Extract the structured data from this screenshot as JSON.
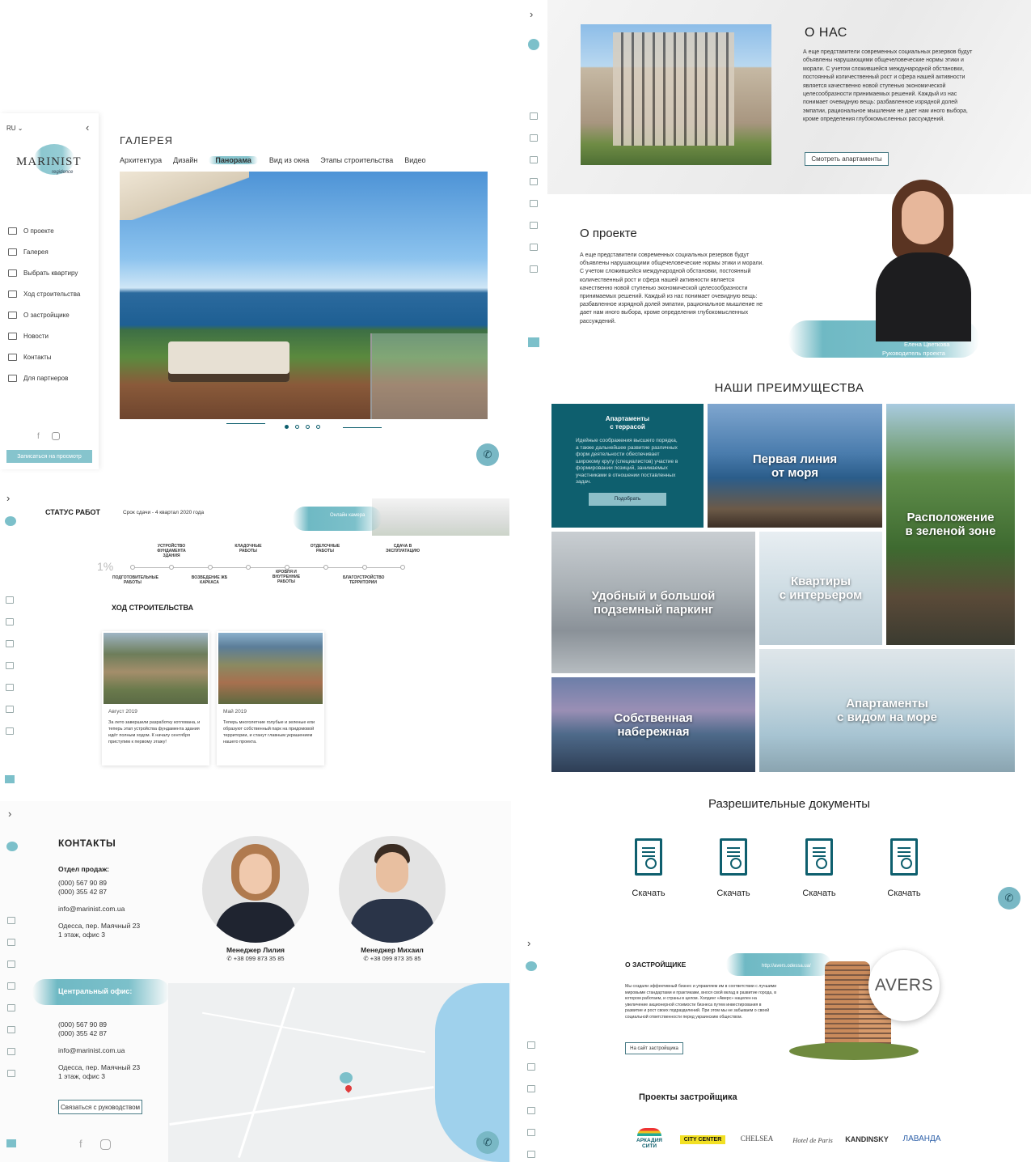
{
  "gallery": {
    "lang": "RU",
    "logo_text": "MARINIST",
    "logo_sub": "regidence",
    "title": "ГАЛЕРЕЯ",
    "tabs": [
      "Архитектура",
      "Дизайн",
      "Панорама",
      "Вид из окна",
      "Этапы строительства",
      "Видео"
    ],
    "active_tab": "Панорама",
    "nav": [
      "О проекте",
      "Галерея",
      "Выбрать квартиру",
      "Ход строительства",
      "О застройщике",
      "Новости",
      "Контакты",
      "Для партнеров"
    ],
    "cta": "Записаться на просмотр"
  },
  "about_us": {
    "title": "О НАС",
    "text": "А еще представители современных социальных резервов будут объявлены нарушающими общечеловеческие нормы этики и морали. С учетом сложившейся международной обстановки, постоянный количественный рост и сфера нашей активности является качественно новой ступенью экономической целесообразности принимаемых решений. Каждый из нас понимает очевидную вещь: разбавленное изрядной долей эмпатии, рациональное мышление не дает нам иного выбора, кроме определения глубокомысленных рассуждений.",
    "button": "Смотреть апартаменты"
  },
  "project": {
    "title": "О проекте",
    "text": "А еще представители современных социальных резервов будут объявлены нарушающими общечеловеческие нормы этики и морали. С учетом сложившейся международной обстановки, постоянный количественный рост и сфера нашей активности является качественно новой ступенью экономической целесообразности принимаемых решений. Каждый из нас понимает очевидную вещь: разбавленное изрядной долей эмпатии, рациональное мышление не дает нам иного выбора, кроме определения глубокомысленных рассуждений.",
    "person_name": "Елена Цветкова",
    "person_role": "Руководитель проекта"
  },
  "advantages": {
    "title": "НАШИ ПРЕИМУЩЕСТВА",
    "featured_title": "Апартаменты\nс террасой",
    "featured_text": "Идейные соображения высшего порядка, а также дальнейшее развитие различных форм деятельности обеспечивает широкому кругу (специалистов) участие в формировании позиций, занимаемых участниками в отношении поставленных задач.",
    "featured_button": "Подобрать",
    "tiles": [
      "Первая линия\nот моря",
      "Расположение\nв зеленой зоне",
      "Удобный и большой\nподземный паркинг",
      "Квартиры\nс интерьером",
      "Собственная\nнабережная",
      "Апартаменты\nс видом на море"
    ]
  },
  "documents": {
    "title": "Разрешительные документы",
    "items": [
      "Скачать",
      "Скачать",
      "Скачать",
      "Скачать"
    ]
  },
  "status": {
    "title": "СТАТУС РАБОТ",
    "deadline": "Срок сдачи - 4 квартал 2020 года",
    "camera": "Онлайн камера",
    "percent": "1%",
    "steps_top": [
      "УСТРОЙСТВО ФУНДАМЕНТА ЗДАНИЯ",
      "КЛАДОЧНЫЕ РАБОТЫ",
      "ОТДЕЛОЧНЫЕ РАБОТЫ",
      "СДАЧА В ЭКСПЛУАТАЦИЮ"
    ],
    "steps_bottom": [
      "ПОДГОТОВИТЕЛЬНЫЕ РАБОТЫ",
      "ВОЗВЕДЕНИЕ ЖБ КАРКАСА",
      "КРОВЛЯ И ВНУТРЕННИЕ РАБОТЫ",
      "БЛАГОУСТРОЙСТВО ТЕРРИТОРИИ"
    ],
    "progress_title": "ХОД СТРОИТЕЛЬСТВА",
    "cards": [
      {
        "date": "Август 2019",
        "text": "За лето завершили разработку котлована, и теперь этап устройства фундамента здания идёт полным ходом. К началу сентября приступим к первому этажу!"
      },
      {
        "date": "Май 2019",
        "text": "Теперь многолетние голубые и зеленые ели образуют собственный парк на придомовой территории, и станут главным украшением нашего проекта."
      }
    ]
  },
  "contacts": {
    "title": "КОНТАКТЫ",
    "sales_label": "Отдел продаж:",
    "phone1": "(000) 567 90 89",
    "phone2": "(000) 355 42 87",
    "email": "info@marinist.com.ua",
    "address1": "Одесса, пер. Маячный 23",
    "address2": "1 этаж, офис 3",
    "managers": [
      {
        "name": "Менеджер Лилия",
        "phone": "+38 099 873 35 85"
      },
      {
        "name": "Менеджер Михаил",
        "phone": "+38 099 873 35 85"
      }
    ],
    "office_label": "Центральный офис:",
    "office_phone1": "(000) 567 90 89",
    "office_phone2": "(000) 355 42 87",
    "office_email": "info@marinist.com.ua",
    "office_address1": "Одесса, пер. Маячный 23",
    "office_address2": "1 этаж, офис 3",
    "contact_button": "Связаться с руководством"
  },
  "developer": {
    "title": "О ЗАСТРОЙЩИКЕ",
    "url": "http://avers.odessa.ua/",
    "text": "Мы создали эффективный бизнес и управляем им в соответствии с лучшими мировыми стандартами и практиками, внося свой вклад в развитие города, в котором работаем, и страны в целом. Холдинг «Аверс» нацелен на увеличение акционерной стоимости бизнеса путем инвестирования в развитие и рост своих подразделений. При этом мы не забываем о своей социальной ответственности перед украинским обществом.",
    "button": "На сайт застройщика",
    "brand": "AVERS",
    "projects_title": "Проекты застройщика",
    "projects": [
      "АРКАДИЯ СИТИ",
      "CITY CENTER",
      "CHELSEA",
      "Hotel de Paris",
      "KANDINSKY",
      "ЛАВАНДА"
    ]
  },
  "colors": {
    "accent": "#0e5f6e",
    "brush": "#6fb9c4",
    "button": "#79b8c5"
  }
}
